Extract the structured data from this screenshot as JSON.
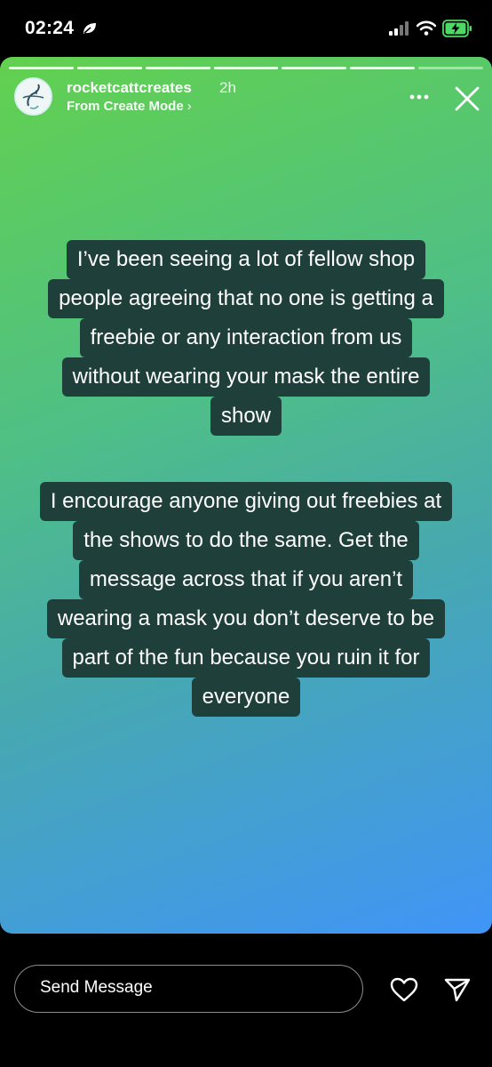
{
  "status_bar": {
    "time": "02:24"
  },
  "story": {
    "segments_total": 7,
    "segments_viewed": 7,
    "username": "rocketcattcreates",
    "age": "2h",
    "subtitle": "From Create Mode",
    "caption_lines_1": [
      "I’ve been seeing a lot of fellow shop",
      "people agreeing that no one is getting a",
      "freebie or any interaction from us",
      "without wearing your mask the entire",
      "show"
    ],
    "caption_lines_2": [
      "I encourage anyone giving out freebies at",
      "the shows to do the same. Get the",
      "message across that if you aren’t",
      "wearing a mask you don’t deserve to be",
      "part of the fun because you ruin it for",
      "everyone"
    ]
  },
  "bottom_bar": {
    "message_placeholder": "Send Message"
  },
  "colors": {
    "caption_bg": "#1e3f3a",
    "gradient_start": "#62d14f",
    "gradient_end": "#4095f7",
    "battery": "#4cd964"
  }
}
